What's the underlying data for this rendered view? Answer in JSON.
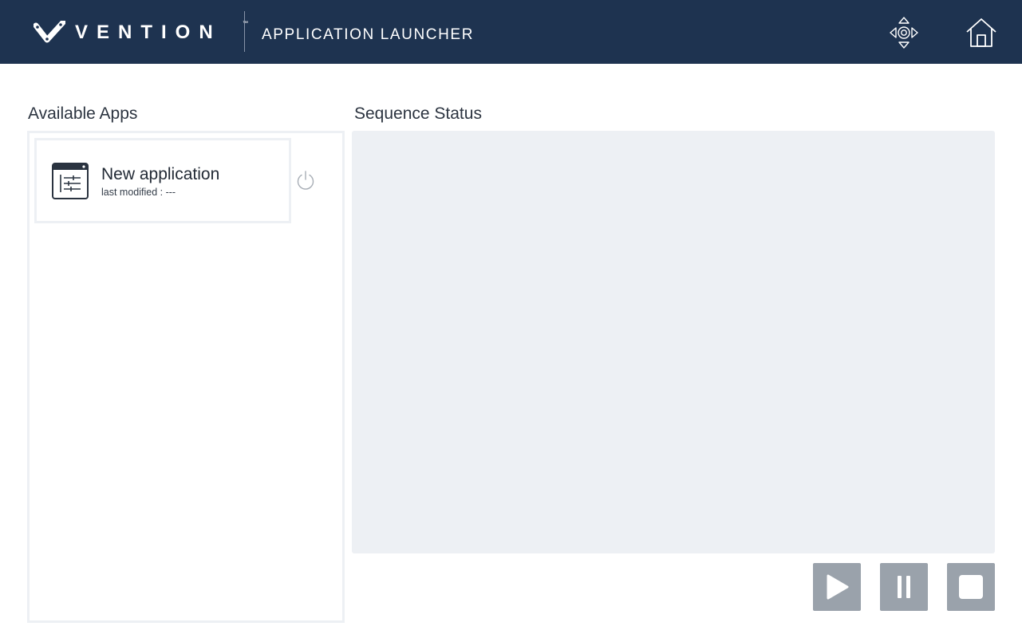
{
  "header": {
    "brand": "VENTION",
    "brand_tm": "™",
    "title": "APPLICATION LAUNCHER",
    "jog_icon": "jog-controls-icon",
    "home_icon": "home-icon",
    "background_color": "#1e3350"
  },
  "apps": {
    "heading": "Available Apps",
    "items": [
      {
        "name": "New application",
        "last_modified": "last modified : ---",
        "icon": "application-settings-icon"
      }
    ],
    "power_icon": "power-icon"
  },
  "sequence": {
    "heading": "Sequence Status"
  },
  "controls": {
    "play_icon": "play-icon",
    "pause_icon": "pause-icon",
    "stop_icon": "stop-icon",
    "button_color": "#9aa2ab"
  }
}
